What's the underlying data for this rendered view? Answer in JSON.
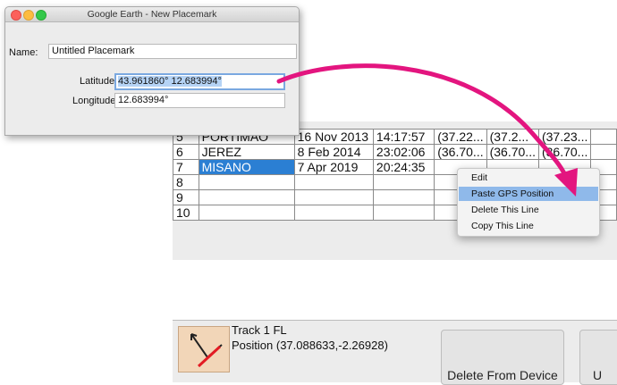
{
  "dialog": {
    "title": "Google Earth - New Placemark",
    "name_label": "Name:",
    "name_value": "Untitled Placemark",
    "latitude_label": "Latitude:",
    "latitude_value": "43.961860° 12.683994°",
    "longitude_label": "Longitude:",
    "longitude_value": "12.683994°"
  },
  "table": {
    "rows": [
      {
        "num": "5",
        "name": "PORTIMAO",
        "date": "16 Nov 2013",
        "time": "14:17:57",
        "c1": "(37.22...",
        "c2": "(37.2...",
        "c3": "(37.23...",
        "c4": ""
      },
      {
        "num": "6",
        "name": "JEREZ",
        "date": "8 Feb 2014",
        "time": "23:02:06",
        "c1": "(36.70...",
        "c2": "(36.70...",
        "c3": "(36.70...",
        "c4": ""
      },
      {
        "num": "7",
        "name": "MISANO",
        "date": "7 Apr 2019",
        "time": "20:24:35",
        "c1": "",
        "c2": "",
        "c3": "",
        "c4": ""
      },
      {
        "num": "8",
        "name": "",
        "date": "",
        "time": "",
        "c1": "",
        "c2": "",
        "c3": "",
        "c4": ""
      },
      {
        "num": "9",
        "name": "",
        "date": "",
        "time": "",
        "c1": "",
        "c2": "",
        "c3": "",
        "c4": ""
      },
      {
        "num": "10",
        "name": "",
        "date": "",
        "time": "",
        "c1": "",
        "c2": "",
        "c3": "",
        "c4": ""
      }
    ],
    "selected_row": "7"
  },
  "context_menu": {
    "items": [
      "Edit",
      "Paste GPS Position",
      "Delete This Line",
      "Copy This Line"
    ],
    "highlighted": "Paste GPS Position"
  },
  "track": {
    "name": "Track 1 FL",
    "position": "Position (37.088633,-2.26928)"
  },
  "buttons": {
    "delete_from_device": "Delete From Device",
    "other": "U"
  },
  "colors": {
    "arrow": "#e3157f",
    "selection": "#2b7fd3",
    "menu_highlight": "#8fb9ea"
  }
}
